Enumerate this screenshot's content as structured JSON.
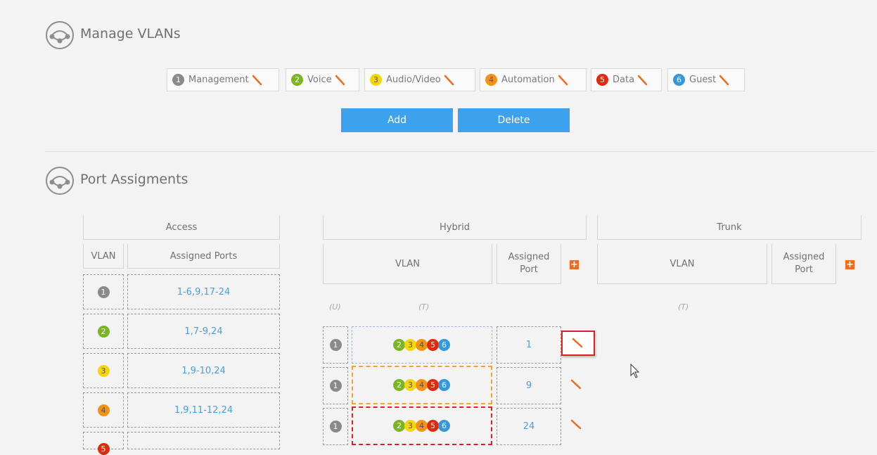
{
  "manage_vlans": {
    "title": "Manage VLANs",
    "vlans": [
      {
        "num": "1",
        "name": "Management",
        "color": "#8a8a8a"
      },
      {
        "num": "2",
        "name": "Voice",
        "color": "#7ab622"
      },
      {
        "num": "3",
        "name": "Audio/Video",
        "color": "#f5d50b"
      },
      {
        "num": "4",
        "name": "Automation",
        "color": "#f39214"
      },
      {
        "num": "5",
        "name": "Data",
        "color": "#dc2c0c"
      },
      {
        "num": "6",
        "name": "Guest",
        "color": "#3498db"
      }
    ],
    "add_label": "Add",
    "delete_label": "Delete"
  },
  "port_assignments": {
    "title": "Port Assigments",
    "access": {
      "header": "Access",
      "col_vlan": "VLAN",
      "col_ports": "Assigned Ports",
      "rows": [
        {
          "vlan": "1",
          "ports": "1-6,9,17-24"
        },
        {
          "vlan": "2",
          "ports": "1,7-9,24"
        },
        {
          "vlan": "3",
          "ports": "1,9-10,24"
        },
        {
          "vlan": "4",
          "ports": "1,9,11-12,24"
        },
        {
          "vlan": "5",
          "ports": ""
        }
      ]
    },
    "hybrid": {
      "header": "Hybrid",
      "col_vlan": "VLAN",
      "col_port": "Assigned Port",
      "untagged_label": "(U)",
      "tagged_label": "(T)",
      "rows": [
        {
          "untagged": "1",
          "tagged": [
            "2",
            "3",
            "4",
            "5",
            "6"
          ],
          "port": "1"
        },
        {
          "untagged": "1",
          "tagged": [
            "2",
            "3",
            "4",
            "5",
            "6"
          ],
          "port": "9"
        },
        {
          "untagged": "1",
          "tagged": [
            "2",
            "3",
            "4",
            "5",
            "6"
          ],
          "port": "24"
        }
      ]
    },
    "trunk": {
      "header": "Trunk",
      "col_vlan": "VLAN",
      "col_port": "Assigned Port",
      "tagged_label": "(T)"
    },
    "add_icon": "plus-icon",
    "edit_icon": "pencil-icon"
  },
  "colors": {
    "accent_blue": "#3ca2ed",
    "link_blue": "#4a9fe0",
    "edit_orange": "#f26a1b",
    "highlight_red": "#e02020"
  }
}
